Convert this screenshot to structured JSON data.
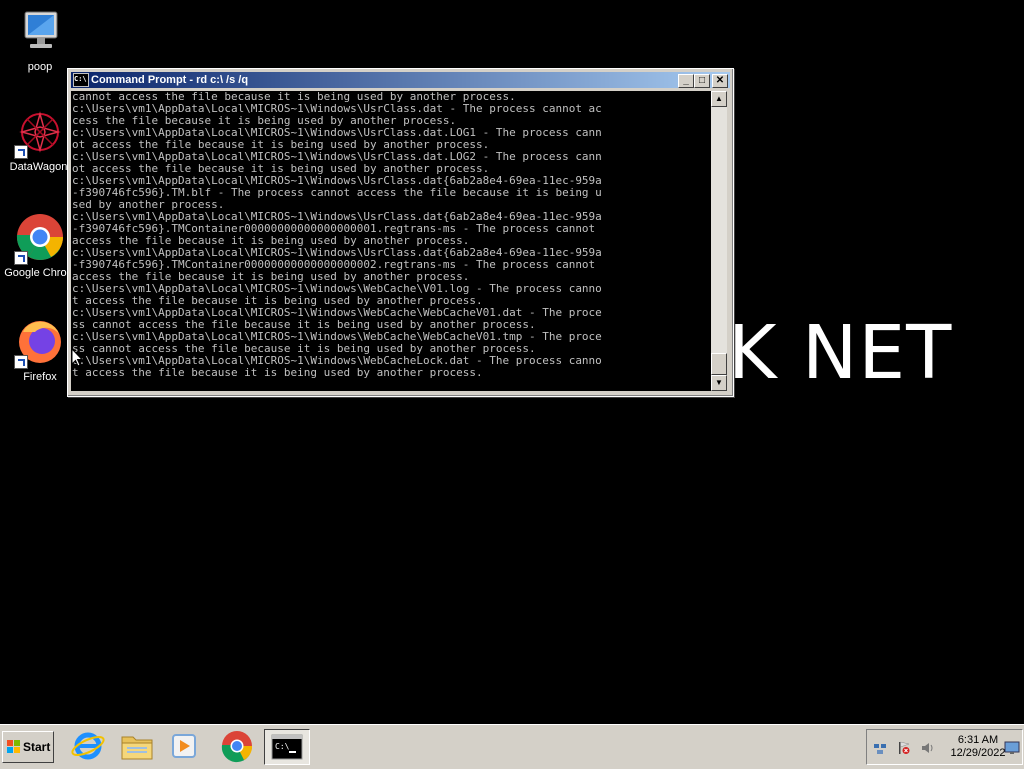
{
  "desktop": {
    "icons": [
      {
        "label": "poop"
      },
      {
        "label": "DataWagon."
      },
      {
        "label": "Google Chrom"
      },
      {
        "label": "Firefox"
      }
    ],
    "wallpaper_text": "K NET"
  },
  "window": {
    "title": "Command Prompt - rd  c:\\ /s /q",
    "minimize": "_",
    "maximize": "□",
    "close": "✕",
    "console_lines": [
      "cannot access the file because it is being used by another process.",
      "c:\\Users\\vm1\\AppData\\Local\\MICROS~1\\Windows\\UsrClass.dat - The process cannot ac",
      "cess the file because it is being used by another process.",
      "c:\\Users\\vm1\\AppData\\Local\\MICROS~1\\Windows\\UsrClass.dat.LOG1 - The process cann",
      "ot access the file because it is being used by another process.",
      "c:\\Users\\vm1\\AppData\\Local\\MICROS~1\\Windows\\UsrClass.dat.LOG2 - The process cann",
      "ot access the file because it is being used by another process.",
      "c:\\Users\\vm1\\AppData\\Local\\MICROS~1\\Windows\\UsrClass.dat{6ab2a8e4-69ea-11ec-959a",
      "-f390746fc596}.TM.blf - The process cannot access the file because it is being u",
      "sed by another process.",
      "c:\\Users\\vm1\\AppData\\Local\\MICROS~1\\Windows\\UsrClass.dat{6ab2a8e4-69ea-11ec-959a",
      "-f390746fc596}.TMContainer00000000000000000001.regtrans-ms - The process cannot",
      "access the file because it is being used by another process.",
      "c:\\Users\\vm1\\AppData\\Local\\MICROS~1\\Windows\\UsrClass.dat{6ab2a8e4-69ea-11ec-959a",
      "-f390746fc596}.TMContainer00000000000000000002.regtrans-ms - The process cannot",
      "access the file because it is being used by another process.",
      "c:\\Users\\vm1\\AppData\\Local\\MICROS~1\\Windows\\WebCache\\V01.log - The process canno",
      "t access the file because it is being used by another process.",
      "c:\\Users\\vm1\\AppData\\Local\\MICROS~1\\Windows\\WebCache\\WebCacheV01.dat - The proce",
      "ss cannot access the file because it is being used by another process.",
      "c:\\Users\\vm1\\AppData\\Local\\MICROS~1\\Windows\\WebCache\\WebCacheV01.tmp - The proce",
      "ss cannot access the file because it is being used by another process.",
      "c:\\Users\\vm1\\AppData\\Local\\MICROS~1\\Windows\\WebCacheLock.dat - The process canno",
      "t access the file because it is being used by another process."
    ]
  },
  "taskbar": {
    "start_label": "Start",
    "apps": [
      {
        "icon": "internet-explorer-icon"
      },
      {
        "icon": "file-explorer-icon"
      },
      {
        "icon": "media-player-icon"
      },
      {
        "icon": "chrome-icon"
      },
      {
        "icon": "command-prompt-icon",
        "active": true
      }
    ],
    "time": "6:31 AM",
    "date": "12/29/2022"
  },
  "colors": {
    "title_start": "#0a246a",
    "title_end": "#a6caf0",
    "console_bg": "#000000",
    "console_fg": "#c0c0c0"
  }
}
